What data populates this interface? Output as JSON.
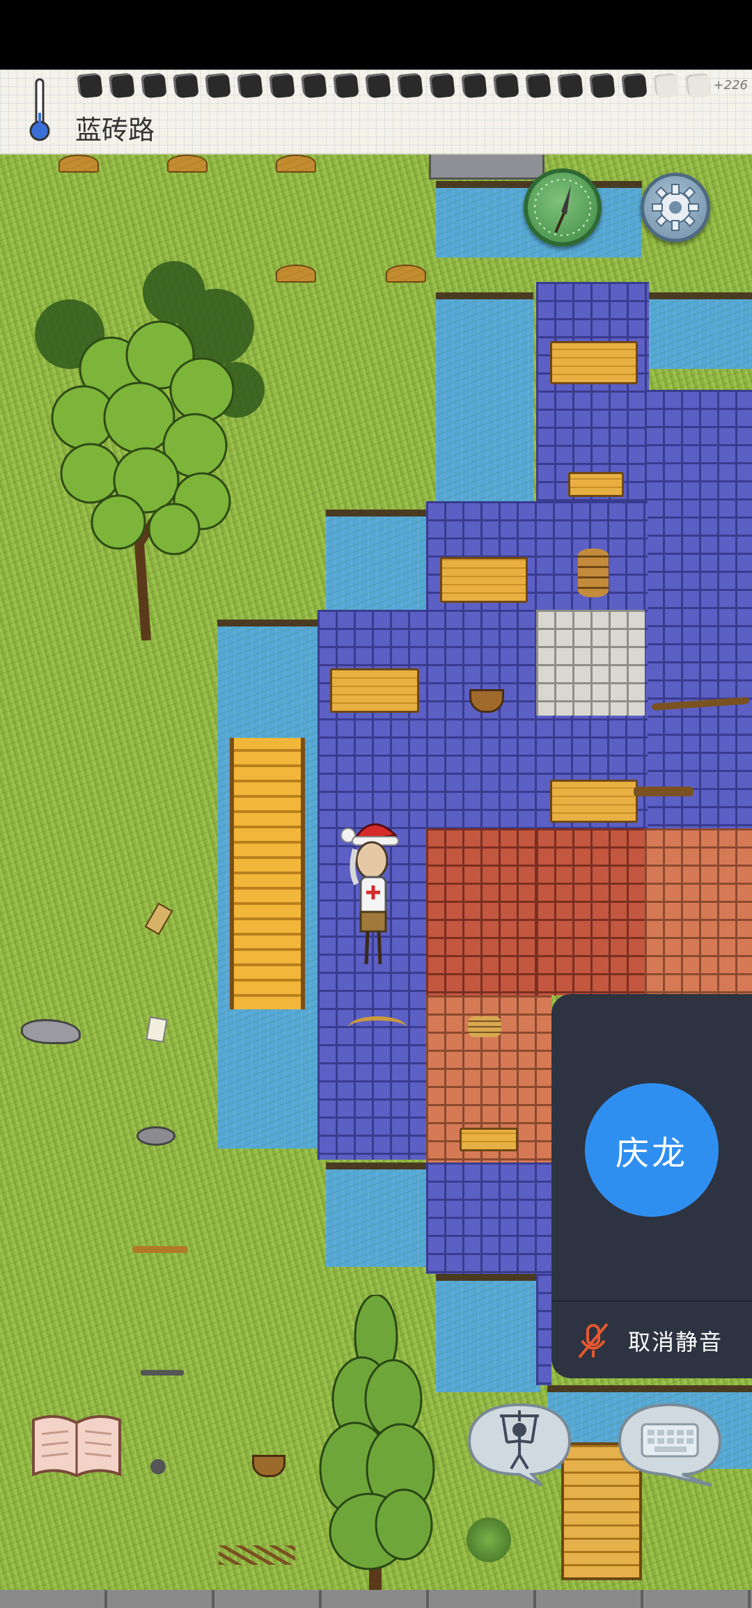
{
  "hud": {
    "location": "蓝砖路",
    "yum_bonus": "+226",
    "food_filled": 18,
    "food_total": 20
  },
  "voice_panel": {
    "avatar_name": "庆龙",
    "unmute_label": "取消静音"
  },
  "icons": {
    "temperature": "thermometer-icon",
    "compass": "compass-icon",
    "settings": "gear-icon",
    "mute": "mic-muted-icon",
    "book": "book-icon",
    "emote": "puppet-icon",
    "chat": "keyboard-icon"
  },
  "colors": {
    "grass": "#9cc24d",
    "blue_brick": "#5c5fc4",
    "red_brick": "#c4573f",
    "water": "#56a9d6",
    "voice_panel": "#2d3340",
    "voice_avatar": "#2f8ff0",
    "mute_icon": "#e8572e"
  }
}
